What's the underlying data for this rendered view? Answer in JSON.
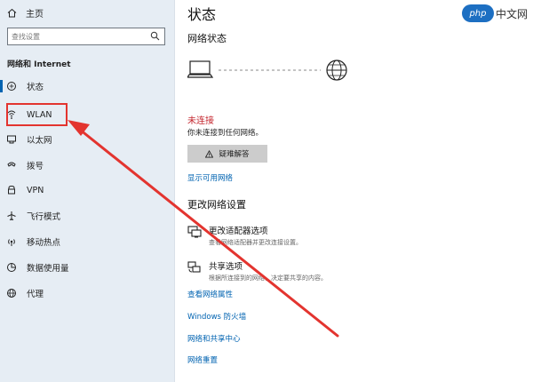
{
  "sidebar": {
    "home_label": "主页",
    "search_placeholder": "查找设置",
    "section_title": "网络和 Internet",
    "items": [
      {
        "label": "状态",
        "icon": "status-icon"
      },
      {
        "label": "WLAN",
        "icon": "wifi-icon"
      },
      {
        "label": "以太网",
        "icon": "ethernet-icon"
      },
      {
        "label": "拨号",
        "icon": "dialup-icon"
      },
      {
        "label": "VPN",
        "icon": "vpn-icon"
      },
      {
        "label": "飞行模式",
        "icon": "airplane-icon"
      },
      {
        "label": "移动热点",
        "icon": "hotspot-icon"
      },
      {
        "label": "数据使用量",
        "icon": "data-usage-icon"
      },
      {
        "label": "代理",
        "icon": "proxy-icon"
      }
    ]
  },
  "main": {
    "title": "状态",
    "subtitle": "网络状态",
    "error_title": "未连接",
    "error_desc": "你未连接到任何网络。",
    "troubleshoot_label": "疑难解答",
    "show_networks_link": "显示可用网络",
    "change_section": "更改网络设置",
    "options": [
      {
        "title": "更改适配器选项",
        "desc": "查看网络适配器并更改连接设置。",
        "icon": "adapter-icon"
      },
      {
        "title": "共享选项",
        "desc": "根据所连接到的网络，决定要共享的内容。",
        "icon": "sharing-icon"
      }
    ],
    "links": [
      "查看网络属性",
      "Windows 防火墙",
      "网络和共享中心",
      "网络重置"
    ]
  },
  "watermark": {
    "logo": "php",
    "text": "中文网"
  },
  "colors": {
    "accent": "#0063b1",
    "error": "#c4262e",
    "annotation": "#e3342f",
    "sidebar_bg": "#e6edf4"
  }
}
